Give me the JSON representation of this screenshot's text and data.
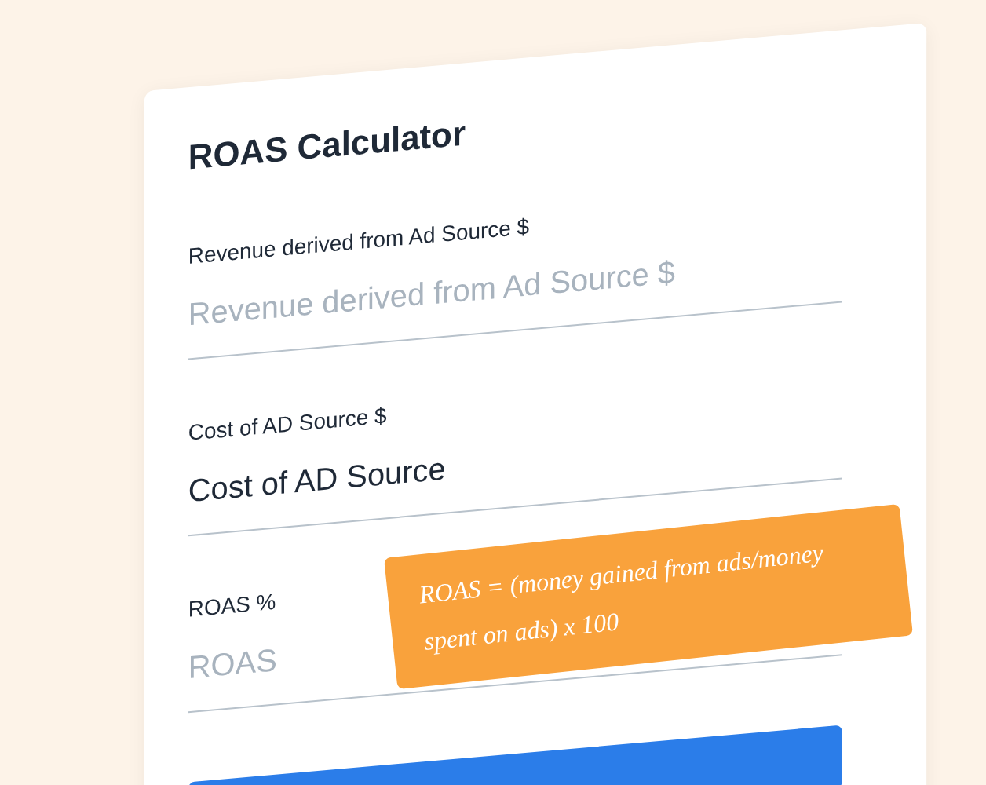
{
  "title": "ROAS Calculator",
  "fields": [
    {
      "label": "Revenue derived from Ad Source $",
      "placeholder": "Revenue derived from Ad Source $"
    },
    {
      "label": "Cost of AD Source $",
      "value": "Cost of AD Source"
    },
    {
      "label": "ROAS %",
      "placeholder": "ROAS"
    }
  ],
  "note": "ROAS = (money gained from ads/money spent on ads) x 100"
}
